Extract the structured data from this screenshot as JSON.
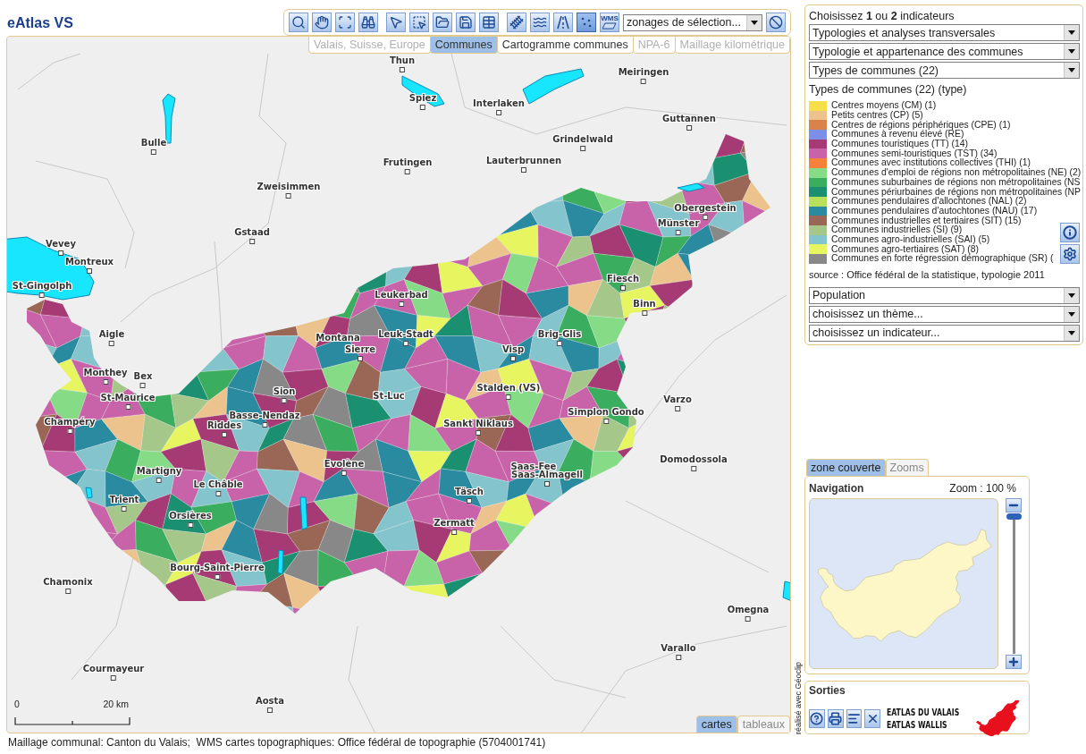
{
  "app_title": "eAtlas VS",
  "toolbar": {
    "tools": [
      {
        "kind": "zoom",
        "selected": false
      },
      {
        "kind": "pan",
        "selected": false
      },
      {
        "kind": "extent",
        "selected": false
      },
      {
        "kind": "find",
        "selected": false
      },
      {
        "kind": "point",
        "selected": false
      },
      {
        "kind": "area",
        "selected": false
      },
      {
        "kind": "open",
        "selected": false
      },
      {
        "kind": "save",
        "selected": false
      },
      {
        "kind": "table",
        "selected": false
      },
      {
        "kind": "rail",
        "selected": false
      },
      {
        "kind": "water",
        "selected": false
      },
      {
        "kind": "road",
        "selected": false
      },
      {
        "kind": "places",
        "selected": true
      },
      {
        "kind": "wms",
        "label": "WMS",
        "selected": false
      }
    ],
    "zoning_select": {
      "value": "zonages de sélection..."
    }
  },
  "map": {
    "tabs": [
      {
        "label": "Valais, Suisse, Europe",
        "selected": false,
        "disabled": true
      },
      {
        "label": "Communes",
        "selected": true,
        "disabled": false
      },
      {
        "label": "Cartogramme communes",
        "selected": false,
        "disabled": false
      },
      {
        "label": "NPA-6",
        "selected": false,
        "disabled": true
      },
      {
        "label": "Maillage kilométrique",
        "selected": false,
        "disabled": true
      }
    ],
    "places": [
      {
        "name": "Thun"
      },
      {
        "name": "Meiringen"
      },
      {
        "name": "Spiez"
      },
      {
        "name": "Interlaken"
      },
      {
        "name": "Guttannen"
      },
      {
        "name": "Bulle"
      },
      {
        "name": "Grindelwald"
      },
      {
        "name": "Frutingen"
      },
      {
        "name": "Lauterbrunnen"
      },
      {
        "name": "Zweisimmen"
      },
      {
        "name": "Obergestein"
      },
      {
        "name": "Münster"
      },
      {
        "name": "Gstaad"
      },
      {
        "name": "Vevey"
      },
      {
        "name": "Montreux"
      },
      {
        "name": "St-Gingolph"
      },
      {
        "name": "Fiesch"
      },
      {
        "name": "Leukerbad"
      },
      {
        "name": "Binn"
      },
      {
        "name": "Aigle"
      },
      {
        "name": "Montana"
      },
      {
        "name": "Leuk-Stadt"
      },
      {
        "name": "Brig-Glis"
      },
      {
        "name": "Sierre"
      },
      {
        "name": "Visp"
      },
      {
        "name": "Monthey"
      },
      {
        "name": "Bex"
      },
      {
        "name": "St-Maurice"
      },
      {
        "name": "Sion"
      },
      {
        "name": "St-Luc"
      },
      {
        "name": "Stalden (VS)"
      },
      {
        "name": "Varzo"
      },
      {
        "name": "Champéry"
      },
      {
        "name": "Riddes"
      },
      {
        "name": "Basse-Nendaz"
      },
      {
        "name": "Sankt Niklaus"
      },
      {
        "name": "Simplon Gondo"
      },
      {
        "name": "Martigny"
      },
      {
        "name": "Evolène"
      },
      {
        "name": "Saas-Fee"
      },
      {
        "name": "Saas-Almagell"
      },
      {
        "name": "Domodossola"
      },
      {
        "name": "Le Châble"
      },
      {
        "name": "Trient"
      },
      {
        "name": "Täsch"
      },
      {
        "name": "Orsières"
      },
      {
        "name": "Zermatt"
      },
      {
        "name": "Bourg-Saint-Pierre"
      },
      {
        "name": "Chamonix"
      },
      {
        "name": "Omegna"
      },
      {
        "name": "Varallo"
      },
      {
        "name": "Courmayeur"
      },
      {
        "name": "Aosta"
      }
    ],
    "scale": {
      "start": "0",
      "end": "20 km"
    },
    "view_tabs": [
      {
        "label": "cartes",
        "selected": true
      },
      {
        "label": "tableaux",
        "selected": false
      }
    ]
  },
  "attribution": "Maillage communal: Canton du Valais;  WMS cartes topographiques: Office fédéral de topographie (5704001741)",
  "credit": "réalisé avec Géoclip",
  "indicators": {
    "heading": "Choisissez **1** ou **2** indicateurs",
    "selects": [
      {
        "value": "Typologies et analyses transversales"
      },
      {
        "value": "Typologie et appartenance des communes"
      },
      {
        "value": "Types de communes (22)"
      }
    ],
    "legend": {
      "title": "Types de communes (22) (type)",
      "items": [
        {
          "label": "Centres moyens (CM) (1)",
          "color": "#f5e04a"
        },
        {
          "label": "Petits centres (CP) (5)",
          "color": "#ecc38c"
        },
        {
          "label": "Centres de régions périphériques (CPE) (1)",
          "color": "#d9834a"
        },
        {
          "label": "Communes à revenu élevé (RE)",
          "color": "#7b8fe8"
        },
        {
          "label": "Communes touristiques (TT) (14)",
          "color": "#a63a74"
        },
        {
          "label": "Communes semi-touristiques (TST) (34)",
          "color": "#c863aa"
        },
        {
          "label": "Communes avec institutions collectives (THI) (1)",
          "color": "#f5813a"
        },
        {
          "label": "Communes d'emploi de régions non métropolitaines (NE) (2)",
          "color": "#86dc86"
        },
        {
          "label": "Communes suburbaines de régions non métropolitaines (NS",
          "color": "#3aae5e"
        },
        {
          "label": "Communes périurbaines de régions non métropolitaines (NP",
          "color": "#1a9070"
        },
        {
          "label": "Communes pendulaires d'allochtones (NAL) (2)",
          "color": "#b8e05a"
        },
        {
          "label": "Communes pendulaires d'autochtones (NAU) (17)",
          "color": "#2a8aa0"
        },
        {
          "label": "Communes industrielles et tertiaires (SIT) (15)",
          "color": "#9a6656"
        },
        {
          "label": "Communes industrielles (SI) (9)",
          "color": "#a6c78a"
        },
        {
          "label": "Communes agro-industrielles (SAI) (5)",
          "color": "#84c4cc"
        },
        {
          "label": "Communes agro-tertiaires (SAT) (8)",
          "color": "#e6f560"
        },
        {
          "label": "Communes en forte régression démographique (SR) (",
          "color": "#888888"
        }
      ]
    },
    "source": "source : Office fédéral de la statistique, typologie 2011",
    "selects_2": [
      {
        "value": "Population"
      },
      {
        "value": "choisissez un thème..."
      },
      {
        "value": "choisissez un indicateur..."
      }
    ]
  },
  "navigation": {
    "tabs": [
      {
        "label": "zone couverte",
        "selected": true
      },
      {
        "label": "Zooms",
        "selected": false
      }
    ],
    "title": "Navigation",
    "zoom": "Zoom : 100 %",
    "zoom_slider": {
      "level": 0
    }
  },
  "outputs": {
    "title": "Sorties",
    "buttons": [
      {
        "kind": "help"
      },
      {
        "kind": "print"
      },
      {
        "kind": "list"
      },
      {
        "kind": "close"
      }
    ],
    "logo_lines": [
      "EATLAS DU VALAIS",
      "EATLAS WALLIS"
    ]
  }
}
